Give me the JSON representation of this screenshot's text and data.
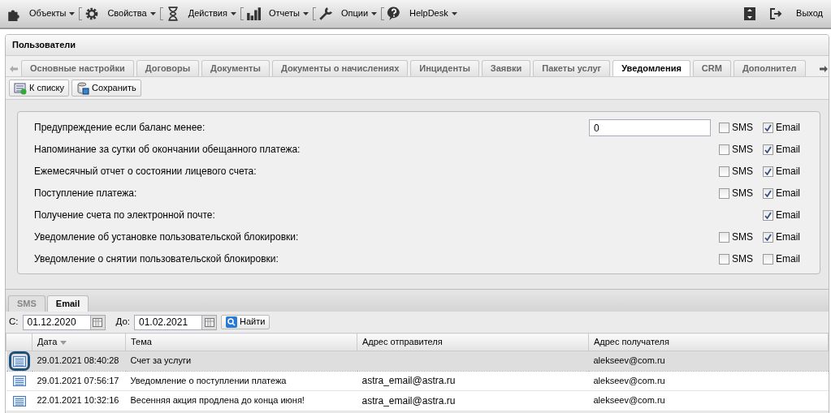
{
  "menu": [
    {
      "label": "Объекты",
      "kind": "puzzle"
    },
    {
      "label": "Свойства",
      "kind": "gear"
    },
    {
      "label": "Действия",
      "kind": "hourglass"
    },
    {
      "label": "Отчеты",
      "kind": "chart"
    },
    {
      "label": "Опции",
      "kind": "wrench"
    },
    {
      "label": "HelpDesk",
      "kind": "help"
    }
  ],
  "exit": {
    "label": "Выход"
  },
  "panel": {
    "title": "Пользователи"
  },
  "tabs": [
    {
      "label": "Основные настройки",
      "selected": false
    },
    {
      "label": "Договоры",
      "selected": false
    },
    {
      "label": "Документы",
      "selected": false
    },
    {
      "label": "Документы о начислениях",
      "selected": false
    },
    {
      "label": "Инциденты",
      "selected": false
    },
    {
      "label": "Заявки",
      "selected": false
    },
    {
      "label": "Пакеты услуг",
      "selected": false
    },
    {
      "label": "Уведомления",
      "selected": true
    },
    {
      "label": "CRM",
      "selected": false
    },
    {
      "label": "Дополнител",
      "selected": false
    }
  ],
  "toolbar": [
    {
      "label": "К списку",
      "kind": "list"
    },
    {
      "label": "Сохранить",
      "kind": "save"
    }
  ],
  "notifications": [
    {
      "label": "Предупреждение если баланс менее:",
      "value": "0",
      "sms": {
        "label": "SMS",
        "checked": false
      },
      "email": {
        "label": "Email",
        "checked": true
      }
    },
    {
      "label": "Напоминание за сутки об окончании обещанного платежа:",
      "sms": {
        "label": "SMS",
        "checked": false
      },
      "email": {
        "label": "Email",
        "checked": true
      }
    },
    {
      "label": "Ежемесячный отчет о состоянии лицевого счета:",
      "sms": {
        "label": "SMS",
        "checked": false
      },
      "email": {
        "label": "Email",
        "checked": true
      }
    },
    {
      "label": "Поступление платежа:",
      "sms": {
        "label": "SMS",
        "checked": false
      },
      "email": {
        "label": "Email",
        "checked": true
      }
    },
    {
      "label": "Получение счета по электронной почте:",
      "email": {
        "label": "Email",
        "checked": true
      }
    },
    {
      "label": "Уведомление об установке пользовательской блокировки:",
      "sms": {
        "label": "SMS",
        "checked": false
      },
      "email": {
        "label": "Email",
        "checked": true
      }
    },
    {
      "label": "Уведомление о снятии пользовательской блокировки:",
      "sms": {
        "label": "SMS",
        "checked": false
      },
      "email": {
        "label": "Email",
        "checked": false
      }
    }
  ],
  "subtabs": [
    {
      "label": "SMS",
      "selected": false
    },
    {
      "label": "Email",
      "selected": true
    }
  ],
  "filter": {
    "from_label": "С:",
    "from_value": "01.12.2020",
    "to_label": "До:",
    "to_value": "01.02.2021",
    "button": "Найти"
  },
  "table": {
    "columns": [
      {
        "label": "Дата",
        "sorted": true
      },
      {
        "label": "Тема",
        "sorted": false
      },
      {
        "label": "Адрес отправителя",
        "sorted": false
      },
      {
        "label": "Адрес получателя",
        "sorted": false
      }
    ],
    "rows": [
      {
        "selected": true,
        "date": "29.01.2021 08:40:28",
        "subject": "Счет за услуги",
        "recipient": "alekseev@com.ru"
      },
      {
        "selected": false,
        "date": "29.01.2021 07:56:17",
        "subject": "Уведомление о поступлении платежа",
        "sender": "astra_email@astra.ru",
        "recipient": "alekseev@com.ru"
      },
      {
        "selected": false,
        "date": "22.01.2021 10:32:16",
        "subject": "Весенняя акция продлена до конца июня!",
        "sender": "astra_email@astra.ru",
        "recipient": "alekseev@com.ru"
      }
    ]
  }
}
